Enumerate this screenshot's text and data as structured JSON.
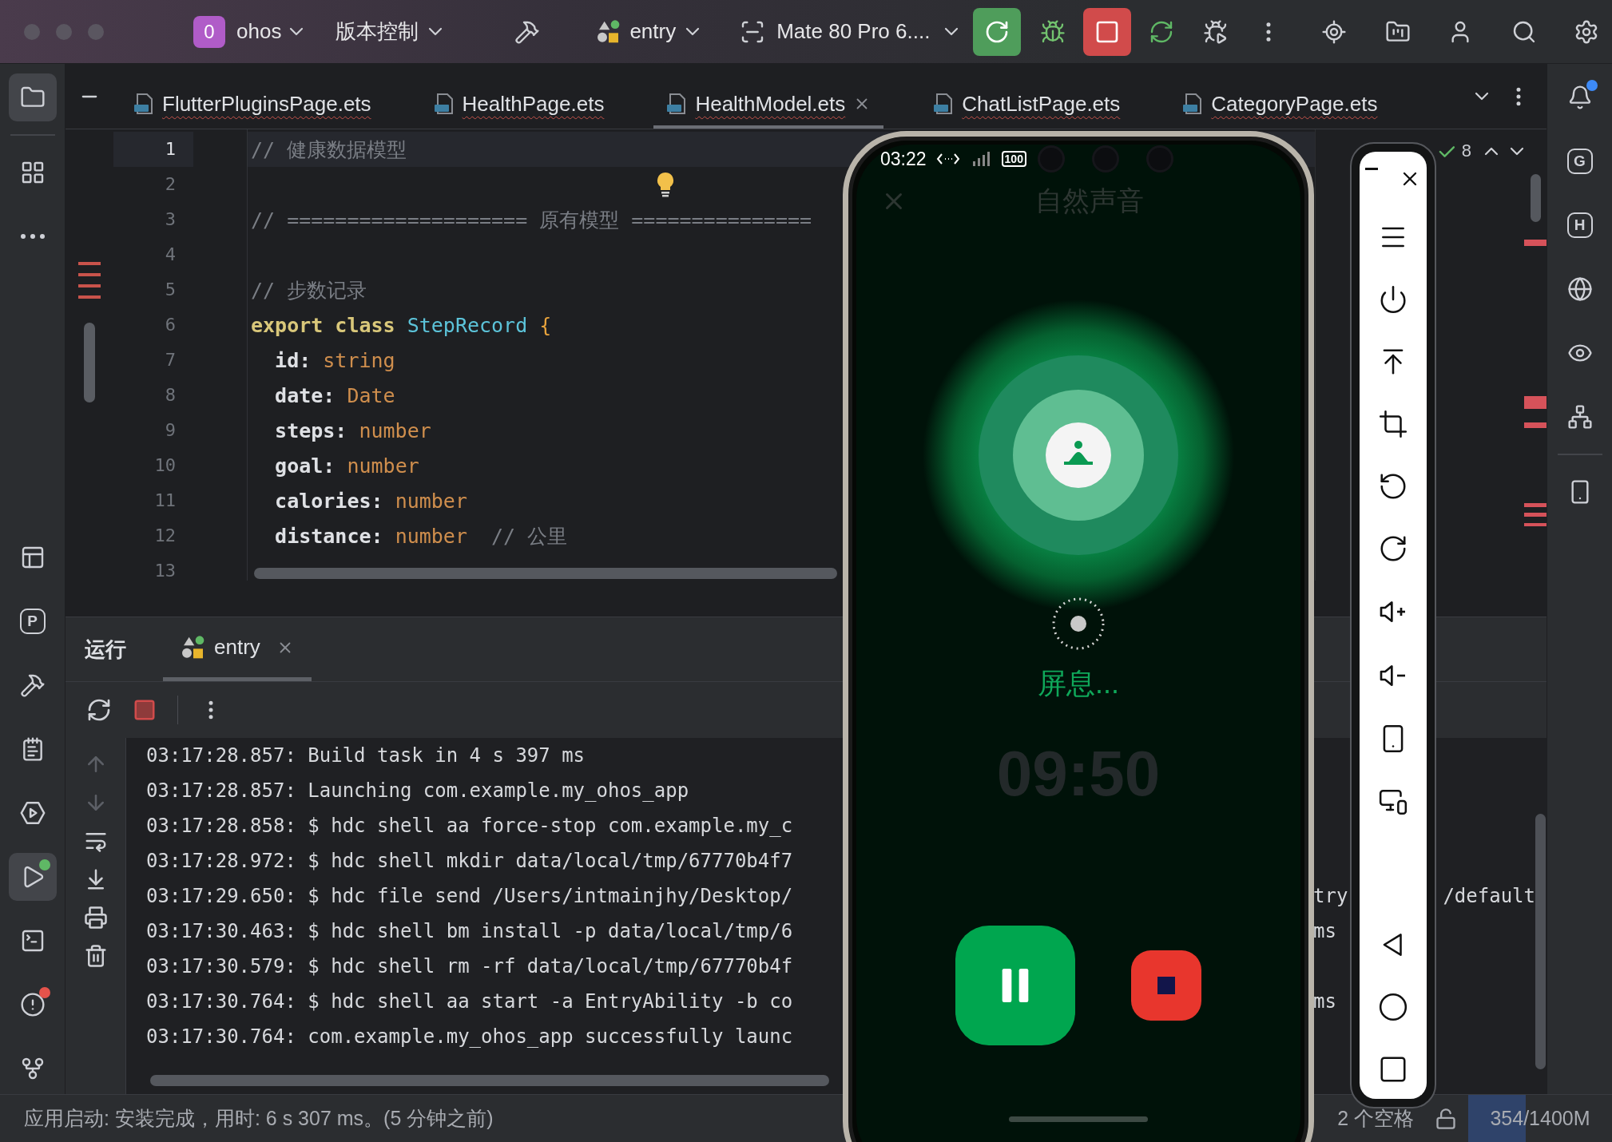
{
  "title_bar": {
    "project_badge": "0",
    "project": "ohos",
    "vcs": "版本控制",
    "run_config": "entry",
    "device": "Mate 80 Pro 6...."
  },
  "left_tools_top": [
    {
      "kind": "project",
      "selected": true
    },
    {
      "kind": "structure",
      "selected": false
    },
    {
      "kind": "more",
      "selected": false
    }
  ],
  "left_tools_bottom": [
    {
      "kind": "table",
      "selected": false
    },
    {
      "kind": "letter",
      "text": "P",
      "selected": false
    },
    {
      "kind": "build",
      "selected": false
    },
    {
      "kind": "notes",
      "selected": false
    },
    {
      "kind": "services",
      "selected": false
    },
    {
      "kind": "run",
      "selected": true,
      "color": "#5fb865"
    },
    {
      "kind": "terminal",
      "selected": false
    },
    {
      "kind": "problems",
      "selected": false,
      "color": "#e5534b"
    },
    {
      "kind": "git",
      "selected": false
    }
  ],
  "right_tools": [
    {
      "kind": "notifications",
      "color": "#3d8af7"
    },
    {
      "kind": "letter",
      "text": "G"
    },
    {
      "kind": "letter",
      "text": "H"
    },
    {
      "kind": "globe"
    },
    {
      "kind": "eye"
    },
    {
      "kind": "network"
    },
    {
      "kind": "divider"
    },
    {
      "kind": "device"
    }
  ],
  "editor_tabs": [
    {
      "label": "FlutterPluginsPage.ets",
      "selected": false
    },
    {
      "label": "HealthPage.ets",
      "selected": false
    },
    {
      "label": "HealthModel.ets",
      "selected": true
    },
    {
      "label": "ChatListPage.ets",
      "selected": false
    },
    {
      "label": "CategoryPage.ets",
      "selected": false
    }
  ],
  "editor": {
    "lines": [
      {
        "number": "1",
        "current": true,
        "tokens": [
          {
            "kind": "comment",
            "text": "// 健康数据模型"
          }
        ]
      },
      {
        "number": "2",
        "current": false,
        "bulb": true
      },
      {
        "number": "3",
        "current": false,
        "tokens": [
          {
            "kind": "comment",
            "text": "// ==================== 原有模型 ==============="
          }
        ]
      },
      {
        "number": "4",
        "current": false
      },
      {
        "number": "5",
        "current": false,
        "tokens": [
          {
            "kind": "comment",
            "text": "// 步数记录"
          }
        ]
      },
      {
        "number": "6",
        "current": false,
        "tokens": [
          {
            "kind": "keyword",
            "text": "export class "
          },
          {
            "kind": "class",
            "text": "StepRecord"
          },
          {
            "kind": "brace",
            "text": " {"
          }
        ]
      },
      {
        "number": "7",
        "current": false,
        "tokens": [
          {
            "kind": "plain",
            "text": "  id: "
          },
          {
            "kind": "type",
            "text": "string"
          }
        ]
      },
      {
        "number": "8",
        "current": false,
        "tokens": [
          {
            "kind": "plain",
            "text": "  date: "
          },
          {
            "kind": "type",
            "text": "Date"
          }
        ]
      },
      {
        "number": "9",
        "current": false,
        "tokens": [
          {
            "kind": "plain",
            "text": "  steps: "
          },
          {
            "kind": "type",
            "text": "number"
          }
        ]
      },
      {
        "number": "10",
        "current": false,
        "tokens": [
          {
            "kind": "plain",
            "text": "  goal: "
          },
          {
            "kind": "type",
            "text": "number"
          }
        ]
      },
      {
        "number": "11",
        "current": false,
        "tokens": [
          {
            "kind": "plain",
            "text": "  calories: "
          },
          {
            "kind": "type",
            "text": "number"
          }
        ]
      },
      {
        "number": "12",
        "current": false,
        "tokens": [
          {
            "kind": "plain",
            "text": "  distance: "
          },
          {
            "kind": "type",
            "text": "number"
          },
          {
            "kind": "comment",
            "text": "  // 公里"
          }
        ]
      },
      {
        "number": "13",
        "current": false
      }
    ],
    "inspection": {
      "passed": "8"
    }
  },
  "run_panel": {
    "title": "运行",
    "tabs": [
      {
        "label": "entry",
        "selected": true
      }
    ],
    "lines": [
      {
        "text": "03:17:28.857: Build task in 4 s 397 ms"
      },
      {
        "text": "03:17:28.857: Launching com.example.my_ohos_app"
      },
      {
        "text": "03:17:28.858: $ hdc shell aa force-stop com.example.my_c"
      },
      {
        "text": "03:17:28.972: $ hdc shell mkdir data/local/tmp/67770b4f7"
      },
      {
        "text": "03:17:29.650: $ hdc file send /Users/intmainjhy/Desktop/",
        "tail_left": "try",
        "tail_right": "/default"
      },
      {
        "text": "03:17:30.463: $ hdc shell bm install -p data/local/tmp/6",
        "tail_left": "ms"
      },
      {
        "text": "03:17:30.579: $ hdc shell rm -rf data/local/tmp/67770b4f"
      },
      {
        "text": "03:17:30.764: $ hdc shell aa start -a EntryAbility -b co",
        "tail_left": "ms"
      },
      {
        "text": "03:17:30.764: com.example.my_ohos_app successfully launc"
      }
    ]
  },
  "phone": {
    "time": "03:22",
    "battery": "100",
    "title": "自然声音",
    "phase": "屏息...",
    "timer": "09:50"
  },
  "status_bar": {
    "message": "应用启动: 安装完成，用时: 6 s 307 ms。(5 分钟之前)",
    "indent": "2 个空格",
    "memory": "354/1400M",
    "level": 0.4
  }
}
